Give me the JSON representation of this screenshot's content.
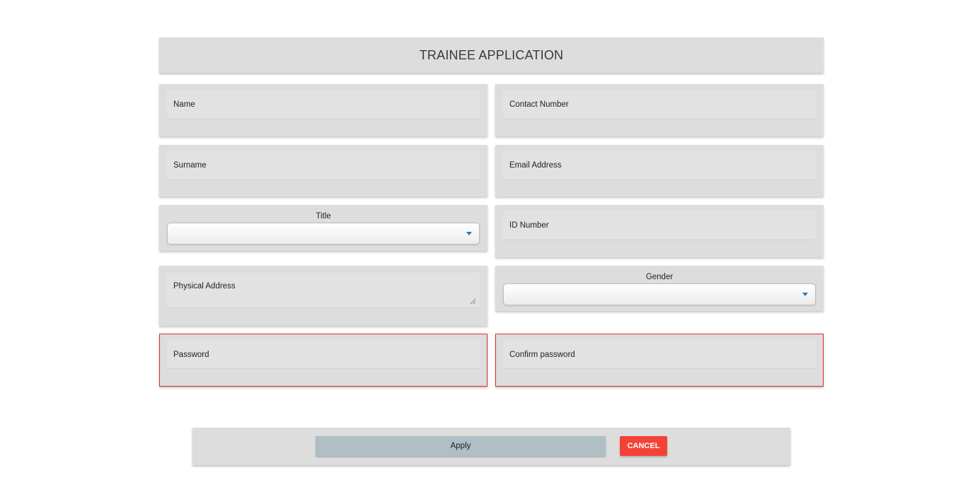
{
  "header": {
    "title": "TRAINEE APPLICATION"
  },
  "form": {
    "name": {
      "label": "Name",
      "value": ""
    },
    "contact_number": {
      "label": "Contact Number",
      "value": ""
    },
    "surname": {
      "label": "Surname",
      "value": ""
    },
    "email_address": {
      "label": "Email Address",
      "value": ""
    },
    "title": {
      "label": "Title",
      "selected": ""
    },
    "id_number": {
      "label": "ID Number",
      "value": ""
    },
    "physical_address": {
      "label": "Physical Address",
      "value": ""
    },
    "gender": {
      "label": "Gender",
      "selected": ""
    },
    "password": {
      "label": "Password",
      "value": "",
      "state": "error"
    },
    "confirm_password": {
      "label": "Confirm password",
      "value": "",
      "state": "error"
    }
  },
  "actions": {
    "apply_label": "Apply",
    "cancel_label": "CANCEL"
  },
  "colors": {
    "card_background": "#dddddd",
    "error_border": "#e32a2a",
    "apply_button": "#b0bec5",
    "cancel_button": "#f44336",
    "select_caret": "#1a7fc1"
  },
  "icons": {
    "select_caret": "caret-down-icon",
    "textarea_resize": "resize-grip-icon"
  }
}
